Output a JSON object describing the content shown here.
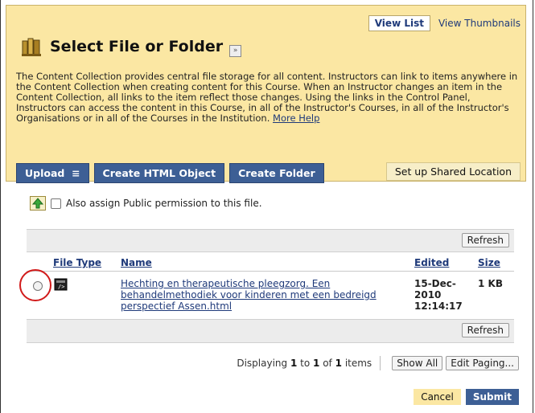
{
  "view_tabs": {
    "list": "View List",
    "thumbnails": "View Thumbnails"
  },
  "page": {
    "title": "Select File or Folder"
  },
  "description": {
    "text": "The Content Collection provides central file storage for all content. Instructors can link to items anywhere in the Content Collection when creating content for this Course. When an Instructor changes an item in the Content Collection, all links to the item reflect those changes. Using the links in the Control Panel, Instructors can access the content in this Course, in all of the Instructor's Courses, in all of the Instructor's Organisations or in all of the Courses in the Institution.",
    "more_help": "More Help"
  },
  "buttons": {
    "upload": "Upload",
    "create_html": "Create HTML Object",
    "create_folder": "Create Folder",
    "shared_location": "Set up Shared Location"
  },
  "upload_permission": {
    "label": "Also assign Public permission to this file."
  },
  "table": {
    "refresh": "Refresh",
    "columns": {
      "file_type": "File Type",
      "name": "Name",
      "edited": "Edited",
      "size": "Size"
    },
    "rows": [
      {
        "name": "Hechting en therapeutische pleegzorg. Een behandelmethodiek voor kinderen met een bedreigd perspectief Assen.html",
        "edited_date": "15-Dec-",
        "edited_year": "2010",
        "edited_time": "12:14:17",
        "size": "1 KB"
      }
    ]
  },
  "paging": {
    "prefix": "Displaying",
    "from": "1",
    "to_word": "to",
    "to": "1",
    "of_word": "of",
    "total": "1",
    "items_word": "items",
    "show_all": "Show All",
    "edit_paging": "Edit Paging..."
  },
  "actions": {
    "cancel": "Cancel",
    "submit": "Submit"
  },
  "colors": {
    "header_bg": "#fbe7a3",
    "button_blue": "#3d5f95",
    "link": "#1f3a7a",
    "highlight": "#d11a1a"
  },
  "icons": {
    "title": "folder-stack-icon",
    "upload": "upload-arrow-icon",
    "file": "html-file-icon",
    "collapse": "double-chevron-down-icon"
  }
}
